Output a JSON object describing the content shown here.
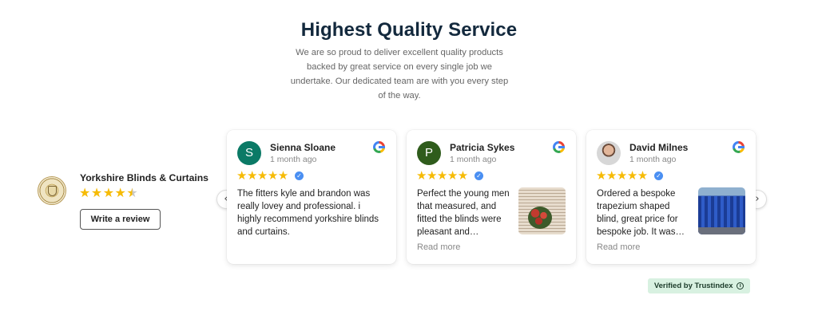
{
  "header": {
    "title": "Highest Quality Service",
    "intro": "We are so proud to deliver excellent quality products backed by great service on every single job we undertake. Our dedicated team are with you every step of the way."
  },
  "business": {
    "name": "Yorkshire Blinds & Curtains",
    "rating_stars": 4.5,
    "stars_full": "★★★★",
    "star_half": "★",
    "write_review_label": "Write a review",
    "logo_icon": "yorkshire-crest-logo"
  },
  "carousel": {
    "prev_icon": "‹",
    "next_icon": "›"
  },
  "reviews": [
    {
      "avatar_letter": "S",
      "avatar_color": "#0b7a66",
      "name": "Sienna Sloane",
      "time": "1 month ago",
      "stars": "★★★★★",
      "rating": 5,
      "text": "The fitters kyle and brandon was really lovey and professional. i highly recommend yorkshire blinds and curtains."
    },
    {
      "avatar_letter": "P",
      "avatar_color": "#2f5c1c",
      "name": "Patricia Sykes",
      "time": "1 month ago",
      "stars": "★★★★★",
      "rating": 5,
      "text": "Perfect the young men that measured, and fitted the blinds were pleasant and…",
      "read_more": "Read more"
    },
    {
      "avatar_letter": "",
      "name": "David Milnes",
      "time": "1 month ago",
      "stars": "★★★★★",
      "rating": 5,
      "text": "Ordered a bespoke trapezium shaped blind, great price for bespoke job. It was…",
      "read_more": "Read more"
    }
  ],
  "verified_check": "✓",
  "trust_badge": {
    "label": "Verified by Trustindex",
    "info_icon": "i"
  },
  "colors": {
    "heading": "#13293d",
    "star": "#f6bb06",
    "verified_blue": "#4a8ff2",
    "trust_badge_bg": "#d8f1e1"
  }
}
